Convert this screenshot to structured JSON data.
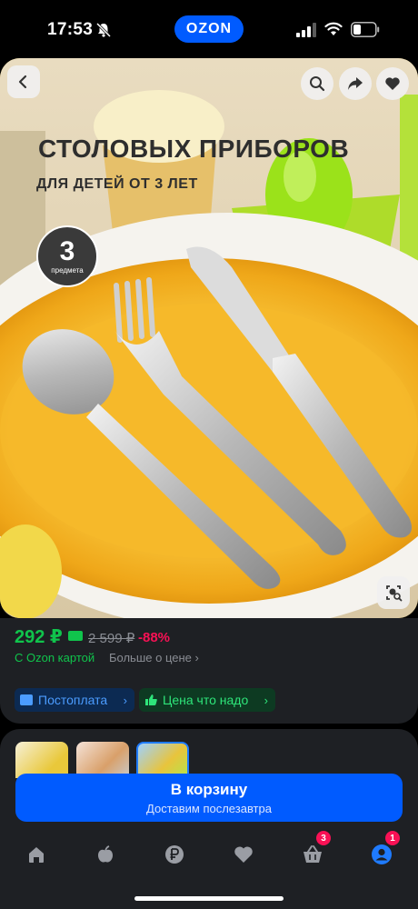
{
  "status_bar": {
    "time": "17:53",
    "brand": "OZON",
    "icons": [
      "bell-slash-icon",
      "cellular-signal-icon",
      "wifi-icon",
      "battery-icon"
    ]
  },
  "product_image": {
    "title": "СТОЛОВЫХ ПРИБОРОВ",
    "subtitle": "ДЛЯ ДЕТЕЙ ОТ 3 ЛЕТ",
    "badge_number": "3",
    "badge_label": "предмета",
    "actions": [
      "back-icon",
      "search-icon",
      "share-icon",
      "heart-icon",
      "image-search-icon"
    ]
  },
  "price": {
    "current": "292 ₽",
    "old": "2 599 ₽",
    "discount": "-88%",
    "ozon_card_note": "С Ozon картой",
    "more_about_price": "Больше о цене ›",
    "colors": {
      "price_green": "#10c44c",
      "discount_pink": "#f91155"
    }
  },
  "chips": {
    "postpay": "Постоплата",
    "good_price": "Цена что надо"
  },
  "cart": {
    "button_label": "В корзину",
    "delivery_note": "Доставим послезавтра",
    "color": "#005bff"
  },
  "bottom_nav": {
    "items": [
      {
        "icon": "home-icon"
      },
      {
        "icon": "fresh-apple-icon"
      },
      {
        "icon": "ruble-icon"
      },
      {
        "icon": "favorites-heart-icon"
      },
      {
        "icon": "cart-icon",
        "badge": "3"
      },
      {
        "icon": "profile-icon",
        "badge": "1"
      }
    ]
  }
}
